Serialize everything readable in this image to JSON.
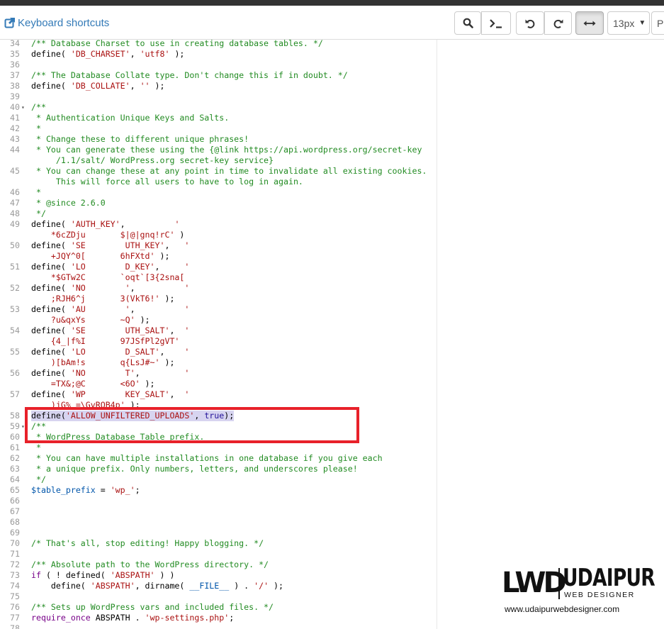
{
  "toolbar": {
    "keyboard_shortcuts_label": "Keyboard shortcuts",
    "font_size_value": "13px",
    "cut_off_label": "Pl",
    "icons": [
      "external-link-icon",
      "search-icon",
      "terminal-icon",
      "undo-icon",
      "redo-icon",
      "word-wrap-icon"
    ]
  },
  "editor": {
    "lines": [
      {
        "n": "34",
        "fold": "",
        "segs": [
          [
            "c",
            "/** Database Charset to use in creating database tables. */"
          ]
        ]
      },
      {
        "n": "35",
        "fold": "",
        "segs": [
          [
            "p",
            "define( "
          ],
          [
            "s",
            "'DB_CHARSET'"
          ],
          [
            "p",
            ", "
          ],
          [
            "s",
            "'utf8'"
          ],
          [
            "p",
            " );"
          ]
        ]
      },
      {
        "n": "36",
        "fold": "",
        "segs": []
      },
      {
        "n": "37",
        "fold": "",
        "segs": [
          [
            "c",
            "/** The Database Collate type. Don't change this if in doubt. */"
          ]
        ]
      },
      {
        "n": "38",
        "fold": "",
        "segs": [
          [
            "p",
            "define( "
          ],
          [
            "s",
            "'DB_COLLATE'"
          ],
          [
            "p",
            ", "
          ],
          [
            "s",
            "''"
          ],
          [
            "p",
            " );"
          ]
        ]
      },
      {
        "n": "39",
        "fold": "",
        "segs": []
      },
      {
        "n": "40",
        "fold": "▾",
        "segs": [
          [
            "c",
            "/**"
          ]
        ]
      },
      {
        "n": "41",
        "fold": "",
        "segs": [
          [
            "c",
            " * Authentication Unique Keys and Salts."
          ]
        ]
      },
      {
        "n": "42",
        "fold": "",
        "segs": [
          [
            "c",
            " *"
          ]
        ]
      },
      {
        "n": "43",
        "fold": "",
        "segs": [
          [
            "c",
            " * Change these to different unique phrases!"
          ]
        ]
      },
      {
        "n": "44",
        "fold": "",
        "segs": [
          [
            "c",
            " * You can generate these using the {@link https://api.wordpress.org/secret-key"
          ]
        ]
      },
      {
        "n": "",
        "fold": "",
        "segs": [
          [
            "c",
            "     /1.1/salt/ WordPress.org secret-key service}"
          ]
        ]
      },
      {
        "n": "45",
        "fold": "",
        "segs": [
          [
            "c",
            " * You can change these at any point in time to invalidate all existing cookies."
          ]
        ]
      },
      {
        "n": "",
        "fold": "",
        "segs": [
          [
            "c",
            "     This will force all users to have to log in again."
          ]
        ]
      },
      {
        "n": "46",
        "fold": "",
        "segs": [
          [
            "c",
            " *"
          ]
        ]
      },
      {
        "n": "47",
        "fold": "",
        "segs": [
          [
            "c",
            " * @since 2.6.0"
          ]
        ]
      },
      {
        "n": "48",
        "fold": "",
        "segs": [
          [
            "c",
            " */"
          ]
        ]
      },
      {
        "n": "49",
        "fold": "",
        "segs": [
          [
            "p",
            "define( "
          ],
          [
            "s",
            "'AUTH_KEY'"
          ],
          [
            "p",
            ",          "
          ],
          [
            "s",
            "'"
          ]
        ]
      },
      {
        "n": "",
        "fold": "",
        "segs": [
          [
            "s",
            "    *6cZDju       $|@|gnq!rC'"
          ],
          [
            "p",
            " )"
          ]
        ]
      },
      {
        "n": "50",
        "fold": "",
        "segs": [
          [
            "p",
            "define( "
          ],
          [
            "s",
            "'SE        UTH_KEY'"
          ],
          [
            "p",
            ",   "
          ],
          [
            "s",
            "'"
          ]
        ]
      },
      {
        "n": "",
        "fold": "",
        "segs": [
          [
            "s",
            "    +JQY^0[       6hFXtd'"
          ],
          [
            "p",
            " );"
          ]
        ]
      },
      {
        "n": "51",
        "fold": "",
        "segs": [
          [
            "p",
            "define( "
          ],
          [
            "s",
            "'LO        D_KEY'"
          ],
          [
            "p",
            ",     "
          ],
          [
            "s",
            "'"
          ]
        ]
      },
      {
        "n": "",
        "fold": "",
        "segs": [
          [
            "s",
            "    *$GTw2C       `oqt`[3{2sna["
          ]
        ]
      },
      {
        "n": "52",
        "fold": "",
        "segs": [
          [
            "p",
            "define( "
          ],
          [
            "s",
            "'NO        '"
          ],
          [
            "p",
            ",          "
          ],
          [
            "s",
            "'"
          ]
        ]
      },
      {
        "n": "",
        "fold": "",
        "segs": [
          [
            "s",
            "    ;RJH6^j       3(VkT6!'"
          ],
          [
            "p",
            " );"
          ]
        ]
      },
      {
        "n": "53",
        "fold": "",
        "segs": [
          [
            "p",
            "define( "
          ],
          [
            "s",
            "'AU        '"
          ],
          [
            "p",
            ",          "
          ],
          [
            "s",
            "'"
          ]
        ]
      },
      {
        "n": "",
        "fold": "",
        "segs": [
          [
            "s",
            "    ?u&qxYs       ~Q'"
          ],
          [
            "p",
            " );"
          ]
        ]
      },
      {
        "n": "54",
        "fold": "",
        "segs": [
          [
            "p",
            "define( "
          ],
          [
            "s",
            "'SE        UTH_SALT'"
          ],
          [
            "p",
            ",  "
          ],
          [
            "s",
            "'"
          ]
        ]
      },
      {
        "n": "",
        "fold": "",
        "segs": [
          [
            "s",
            "    {4_|f%I       97JSfPl2gVT'"
          ]
        ]
      },
      {
        "n": "55",
        "fold": "",
        "segs": [
          [
            "p",
            "define( "
          ],
          [
            "s",
            "'LO        D_SALT'"
          ],
          [
            "p",
            ",    "
          ],
          [
            "s",
            "'"
          ]
        ]
      },
      {
        "n": "",
        "fold": "",
        "segs": [
          [
            "s",
            "    )[bAm!s       q{LsJ#~'"
          ],
          [
            "p",
            " );"
          ]
        ]
      },
      {
        "n": "56",
        "fold": "",
        "segs": [
          [
            "p",
            "define( "
          ],
          [
            "s",
            "'NO        T'"
          ],
          [
            "p",
            ",         "
          ],
          [
            "s",
            "'"
          ]
        ]
      },
      {
        "n": "",
        "fold": "",
        "segs": [
          [
            "s",
            "    =TX&;@C       <6O'"
          ],
          [
            "p",
            " );"
          ]
        ]
      },
      {
        "n": "57",
        "fold": "",
        "segs": [
          [
            "p",
            "define( "
          ],
          [
            "s",
            "'WP        KEY_SALT'"
          ],
          [
            "p",
            ",  "
          ],
          [
            "s",
            "'"
          ]
        ]
      },
      {
        "n": "",
        "fold": "",
        "segs": [
          [
            "s",
            "    )jG%_=\\GvROB4p'"
          ],
          [
            "p",
            " );"
          ]
        ]
      },
      {
        "n": "58",
        "fold": "",
        "sel": true,
        "segs": [
          [
            "p",
            "define("
          ],
          [
            "s",
            "'ALLOW_UNFILTERED_UPLOADS'"
          ],
          [
            "p",
            ", "
          ],
          [
            "a",
            "true"
          ],
          [
            "p",
            ");"
          ]
        ]
      },
      {
        "n": "59",
        "fold": "▾",
        "segs": [
          [
            "c",
            "/**"
          ]
        ]
      },
      {
        "n": "60",
        "fold": "",
        "segs": [
          [
            "c",
            " * WordPress Database Table prefix."
          ]
        ]
      },
      {
        "n": "61",
        "fold": "",
        "segs": [
          [
            "c",
            " *"
          ]
        ]
      },
      {
        "n": "62",
        "fold": "",
        "segs": [
          [
            "c",
            " * You can have multiple installations in one database if you give each"
          ]
        ]
      },
      {
        "n": "63",
        "fold": "",
        "segs": [
          [
            "c",
            " * a unique prefix. Only numbers, letters, and underscores please!"
          ]
        ]
      },
      {
        "n": "64",
        "fold": "",
        "segs": [
          [
            "c",
            " */"
          ]
        ]
      },
      {
        "n": "65",
        "fold": "",
        "segs": [
          [
            "v",
            "$table_prefix"
          ],
          [
            "p",
            " = "
          ],
          [
            "s",
            "'wp_'"
          ],
          [
            "p",
            ";"
          ]
        ]
      },
      {
        "n": "66",
        "fold": "",
        "segs": []
      },
      {
        "n": "67",
        "fold": "",
        "segs": []
      },
      {
        "n": "68",
        "fold": "",
        "segs": []
      },
      {
        "n": "69",
        "fold": "",
        "segs": []
      },
      {
        "n": "70",
        "fold": "",
        "segs": [
          [
            "c",
            "/* That's all, stop editing! Happy blogging. */"
          ]
        ]
      },
      {
        "n": "71",
        "fold": "",
        "segs": []
      },
      {
        "n": "72",
        "fold": "",
        "segs": [
          [
            "c",
            "/** Absolute path to the WordPress directory. */"
          ]
        ]
      },
      {
        "n": "73",
        "fold": "",
        "segs": [
          [
            "k",
            "if"
          ],
          [
            "p",
            " ( ! defined( "
          ],
          [
            "s",
            "'ABSPATH'"
          ],
          [
            "p",
            " ) )"
          ]
        ]
      },
      {
        "n": "74",
        "fold": "",
        "segs": [
          [
            "p",
            "    define( "
          ],
          [
            "s",
            "'ABSPATH'"
          ],
          [
            "p",
            ", dirname( "
          ],
          [
            "v",
            "__FILE__"
          ],
          [
            "p",
            " ) . "
          ],
          [
            "s",
            "'/'"
          ],
          [
            "p",
            " );"
          ]
        ]
      },
      {
        "n": "75",
        "fold": "",
        "segs": []
      },
      {
        "n": "76",
        "fold": "",
        "segs": [
          [
            "c",
            "/** Sets up WordPress vars and included files. */"
          ]
        ]
      },
      {
        "n": "77",
        "fold": "",
        "segs": [
          [
            "k",
            "require_once"
          ],
          [
            "p",
            " ABSPATH . "
          ],
          [
            "s",
            "'wp-settings.php'"
          ],
          [
            "p",
            ";"
          ]
        ]
      },
      {
        "n": "78",
        "fold": "",
        "segs": []
      }
    ]
  },
  "watermark": {
    "mark": "LWD",
    "name": "UDAIPUR",
    "subtitle": "WEB DESIGNER",
    "url": "www.udaipurwebdesigner.com"
  }
}
